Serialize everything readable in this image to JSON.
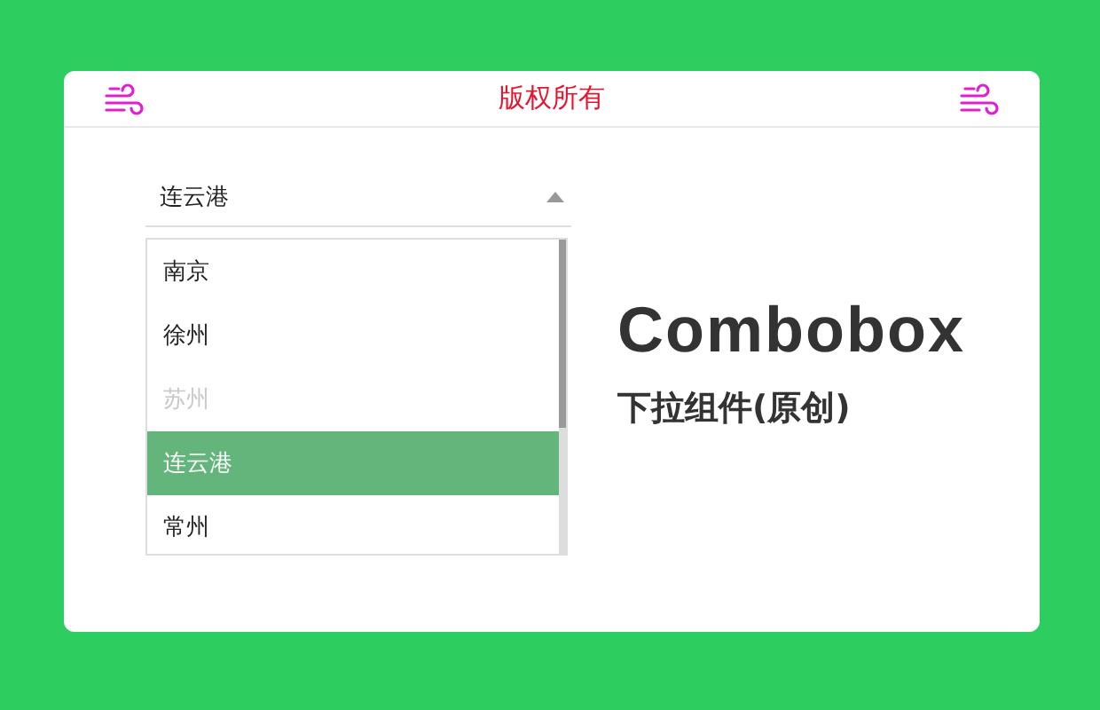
{
  "header": {
    "title": "版权所有"
  },
  "combobox": {
    "value": "连云港",
    "expanded": true,
    "options": [
      {
        "label": "南京",
        "disabled": false,
        "selected": false
      },
      {
        "label": "徐州",
        "disabled": false,
        "selected": false
      },
      {
        "label": "苏州",
        "disabled": true,
        "selected": false
      },
      {
        "label": "连云港",
        "disabled": false,
        "selected": true
      },
      {
        "label": "常州",
        "disabled": false,
        "selected": false
      }
    ]
  },
  "heading": {
    "title": "Combobox",
    "subtitle": "下拉组件(原创)"
  }
}
